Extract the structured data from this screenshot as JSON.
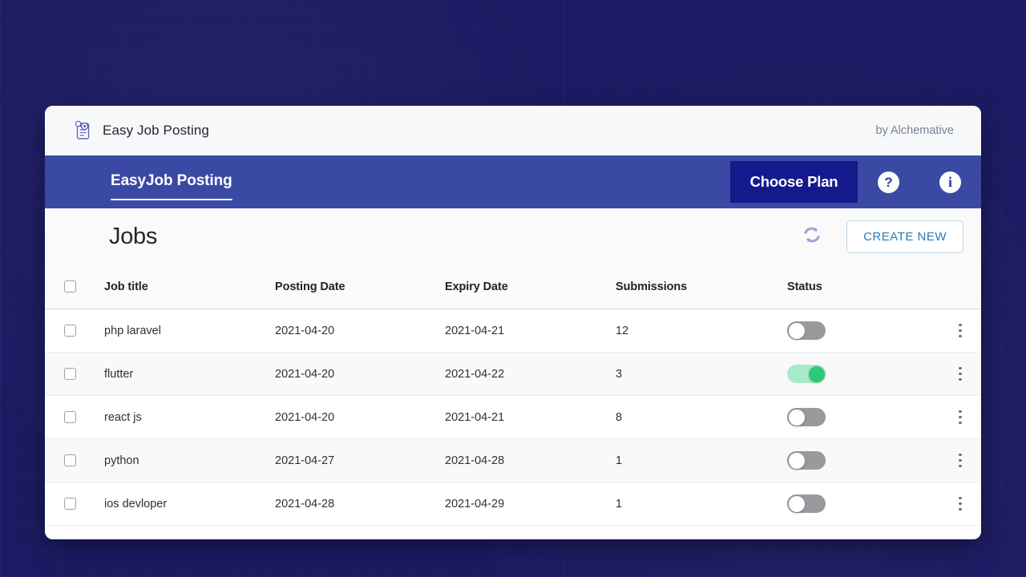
{
  "window": {
    "app_icon": "job-document-icon",
    "title": "Easy Job Posting",
    "byline": "by Alchemative"
  },
  "navbar": {
    "tab_label": "EasyJob Posting",
    "choose_plan_label": "Choose Plan",
    "help_icon_glyph": "?",
    "help_icon_name": "help-icon",
    "info_icon_glyph": "i",
    "info_icon_name": "info-icon",
    "bar_color": "#3a4aa4",
    "button_color": "#141a8c"
  },
  "page": {
    "title": "Jobs",
    "refresh_icon": "refresh-icon",
    "create_new_label": "CREATE NEW"
  },
  "table": {
    "headers": {
      "select_all": "",
      "job_title": "Job title",
      "posting_date": "Posting Date",
      "expiry_date": "Expiry Date",
      "submissions": "Submissions",
      "status": "Status"
    },
    "rows": [
      {
        "job_title": "php laravel",
        "posting_date": "2021-04-20",
        "expiry_date": "2021-04-21",
        "submissions": "12",
        "status_on": false
      },
      {
        "job_title": "flutter",
        "posting_date": "2021-04-20",
        "expiry_date": "2021-04-22",
        "submissions": "3",
        "status_on": true
      },
      {
        "job_title": "react js",
        "posting_date": "2021-04-20",
        "expiry_date": "2021-04-21",
        "submissions": "8",
        "status_on": false
      },
      {
        "job_title": "python",
        "posting_date": "2021-04-27",
        "expiry_date": "2021-04-28",
        "submissions": "1",
        "status_on": false
      },
      {
        "job_title": "ios devloper",
        "posting_date": "2021-04-28",
        "expiry_date": "2021-04-29",
        "submissions": "1",
        "status_on": false
      }
    ]
  },
  "colors": {
    "backdrop": "#1b1b63",
    "nav_blue": "#3a4aa4",
    "plan_blue": "#141a8c",
    "toggle_on": "#2bc978",
    "toggle_off": "#9a9a9e",
    "link_blue": "#2b7cb3"
  }
}
